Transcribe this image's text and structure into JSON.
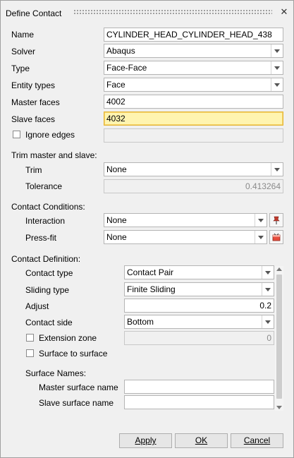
{
  "title": "Define Contact",
  "fields": {
    "name_label": "Name",
    "name_value": "CYLINDER_HEAD_CYLINDER_HEAD_438",
    "solver_label": "Solver",
    "solver_value": "Abaqus",
    "type_label": "Type",
    "type_value": "Face-Face",
    "entity_label": "Entity types",
    "entity_value": "Face",
    "master_label": "Master faces",
    "master_value": "4002",
    "slave_label": "Slave faces",
    "slave_value": "4032",
    "ignore_label": "Ignore edges",
    "ignore_value": ""
  },
  "trim": {
    "section": "Trim master and slave:",
    "trim_label": "Trim",
    "trim_value": "None",
    "tol_label": "Tolerance",
    "tol_value": "0.413264"
  },
  "conditions": {
    "section": "Contact Conditions:",
    "interaction_label": "Interaction",
    "interaction_value": "None",
    "pressfit_label": "Press-fit",
    "pressfit_value": "None"
  },
  "definition": {
    "section": "Contact Definition:",
    "ctype_label": "Contact type",
    "ctype_value": "Contact Pair",
    "sliding_label": "Sliding type",
    "sliding_value": "Finite Sliding",
    "adjust_label": "Adjust",
    "adjust_value": "0.2",
    "side_label": "Contact side",
    "side_value": "Bottom",
    "ext_label": "Extension zone",
    "ext_value": "0",
    "s2s_label": "Surface to surface",
    "surf_section": "Surface Names:",
    "master_surf_label": "Master surface name",
    "master_surf_value": "",
    "slave_surf_label": "Slave surface name",
    "slave_surf_value": ""
  },
  "buttons": {
    "apply": "Apply",
    "ok": "OK",
    "cancel": "Cancel"
  },
  "close_glyph": "✕",
  "colors": {
    "highlight": "#fff4b0",
    "icon_red": "#c0392b"
  }
}
